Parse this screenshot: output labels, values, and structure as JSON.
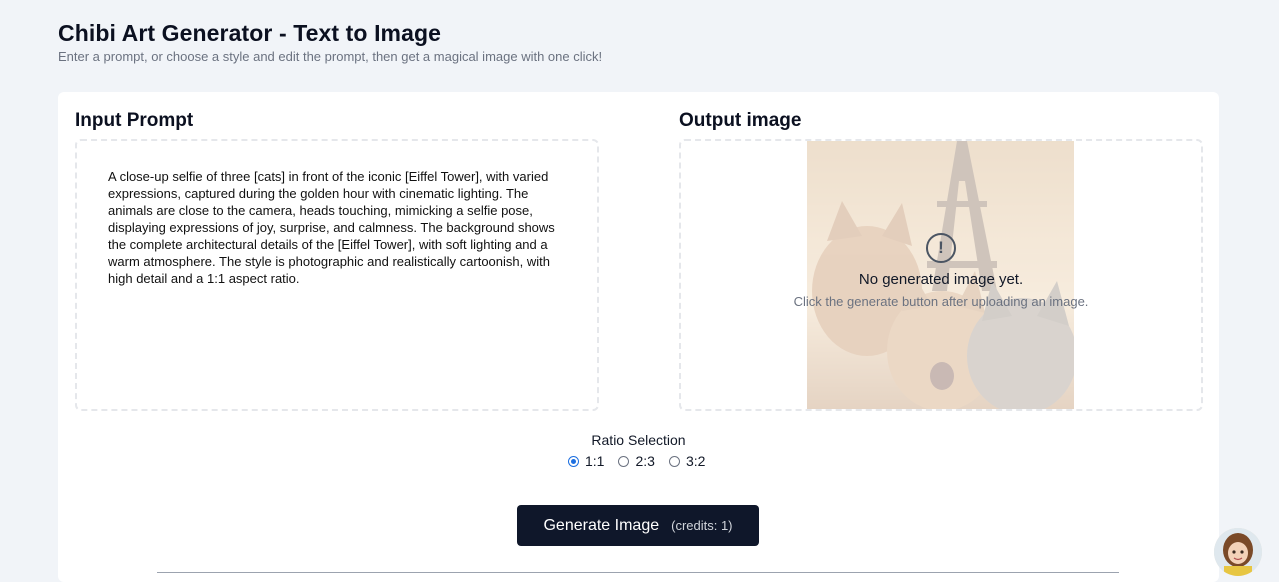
{
  "header": {
    "title": "Chibi Art Generator - Text to Image",
    "subtitle": "Enter a prompt, or choose a style and edit the prompt, then get a magical image with one click!"
  },
  "input": {
    "title": "Input Prompt",
    "prompt": "A close-up selfie of three [cats] in front of the iconic [Eiffel Tower], with varied expressions, captured during the golden hour with cinematic lighting. The animals are close to the camera, heads touching, mimicking a selfie pose, displaying expressions of joy, surprise, and calmness. The background shows the complete architectural details of the [Eiffel Tower], with soft lighting and a warm atmosphere. The style is photographic and realistically cartoonish, with high detail and a 1:1 aspect ratio."
  },
  "output": {
    "title": "Output image",
    "empty_title": "No generated image yet.",
    "empty_hint": "Click the generate button after uploading an image.",
    "icon": "exclamation-circle-icon"
  },
  "ratio": {
    "label": "Ratio Selection",
    "options": [
      "1:1",
      "2:3",
      "3:2"
    ],
    "selected": "1:1"
  },
  "generate": {
    "label": "Generate Image",
    "credits": "(credits: 1)"
  },
  "colors": {
    "page_bg": "#f1f4f8",
    "button_bg": "#0f172a",
    "radio_accent": "#1d6fe0"
  }
}
